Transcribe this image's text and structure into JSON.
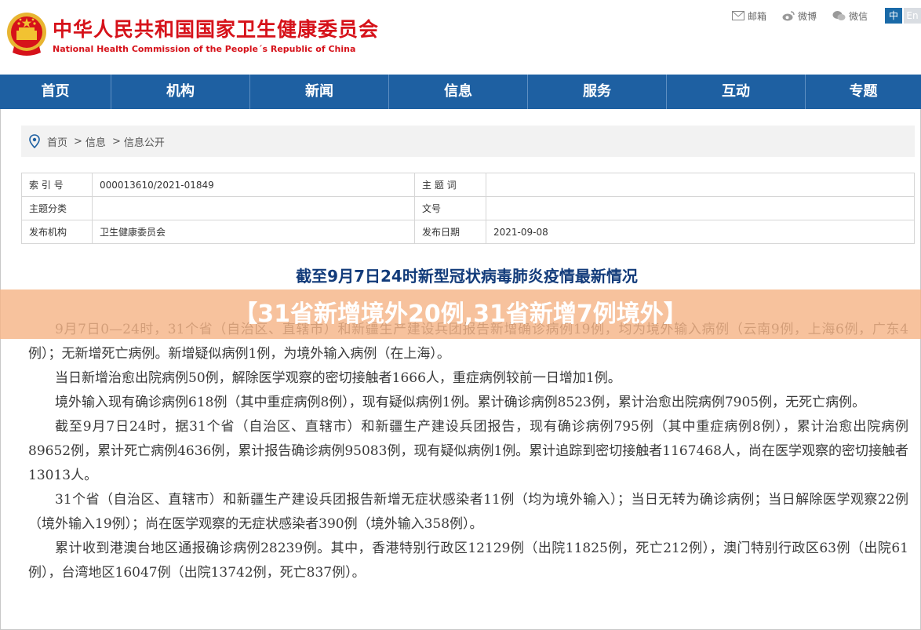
{
  "header": {
    "title_cn": "中华人民共和国国家卫生健康委员会",
    "title_en": "National Health Commission of the People´s Republic of China",
    "links": [
      {
        "label": "邮箱",
        "icon": "mail-icon"
      },
      {
        "label": "微博",
        "icon": "weibo-icon"
      },
      {
        "label": "微信",
        "icon": "wechat-icon"
      }
    ],
    "lang_zh": "中",
    "lang_en": "En"
  },
  "nav": {
    "items": [
      "首页",
      "机构",
      "新闻",
      "信息",
      "服务",
      "互动",
      "专题"
    ]
  },
  "breadcrumb": {
    "items": [
      "首页",
      "信息",
      "信息公开"
    ],
    "separator": ">"
  },
  "info_table": {
    "index_label": "索 引 号",
    "index_value": "000013610/2021-01849",
    "topic_word_label": "主 题 词",
    "topic_word_value": "",
    "topic_category_label": "主题分类",
    "topic_category_value": "",
    "doc_no_label": "文号",
    "doc_no_value": "",
    "issuer_label": "发布机构",
    "issuer_value": "卫生健康委员会",
    "date_label": "发布日期",
    "date_value": "2021-09-08"
  },
  "article": {
    "title": "截至9月7日24时新型冠状病毒肺炎疫情最新情况",
    "paragraphs": [
      "9月7日0—24时，31个省（自治区、直辖市）和新疆生产建设兵团报告新增确诊病例19例，均为境外输入病例（云南9例，上海6例，广东4例）；无新增死亡病例。新增疑似病例1例，为境外输入病例（在上海）。",
      "当日新增治愈出院病例50例，解除医学观察的密切接触者1666人，重症病例较前一日增加1例。",
      "境外输入现有确诊病例618例（其中重症病例8例），现有疑似病例1例。累计确诊病例8523例，累计治愈出院病例7905例，无死亡病例。",
      "截至9月7日24时，据31个省（自治区、直辖市）和新疆生产建设兵团报告，现有确诊病例795例（其中重症病例8例），累计治愈出院病例89652例，累计死亡病例4636例，累计报告确诊病例95083例，现有疑似病例1例。累计追踪到密切接触者1167468人，尚在医学观察的密切接触者13013人。",
      "31个省（自治区、直辖市）和新疆生产建设兵团报告新增无症状感染者11例（均为境外输入）；当日无转为确诊病例；当日解除医学观察22例（境外输入19例）；尚在医学观察的无症状感染者390例（境外输入358例）。",
      "累计收到港澳台地区通报确诊病例28239例。其中，香港特别行政区12129例（出院11825例，死亡212例），澳门特别行政区63例（出院61例），台湾地区16047例（出院13742例，死亡837例）。"
    ]
  },
  "overlay": {
    "text": "【31省新增境外20例,31省新增7例境外】"
  },
  "colors": {
    "brand_red": "#d6121a",
    "nav_blue": "#1e60a2",
    "title_blue": "#123b7a",
    "overlay_orange": "#f5b588"
  }
}
